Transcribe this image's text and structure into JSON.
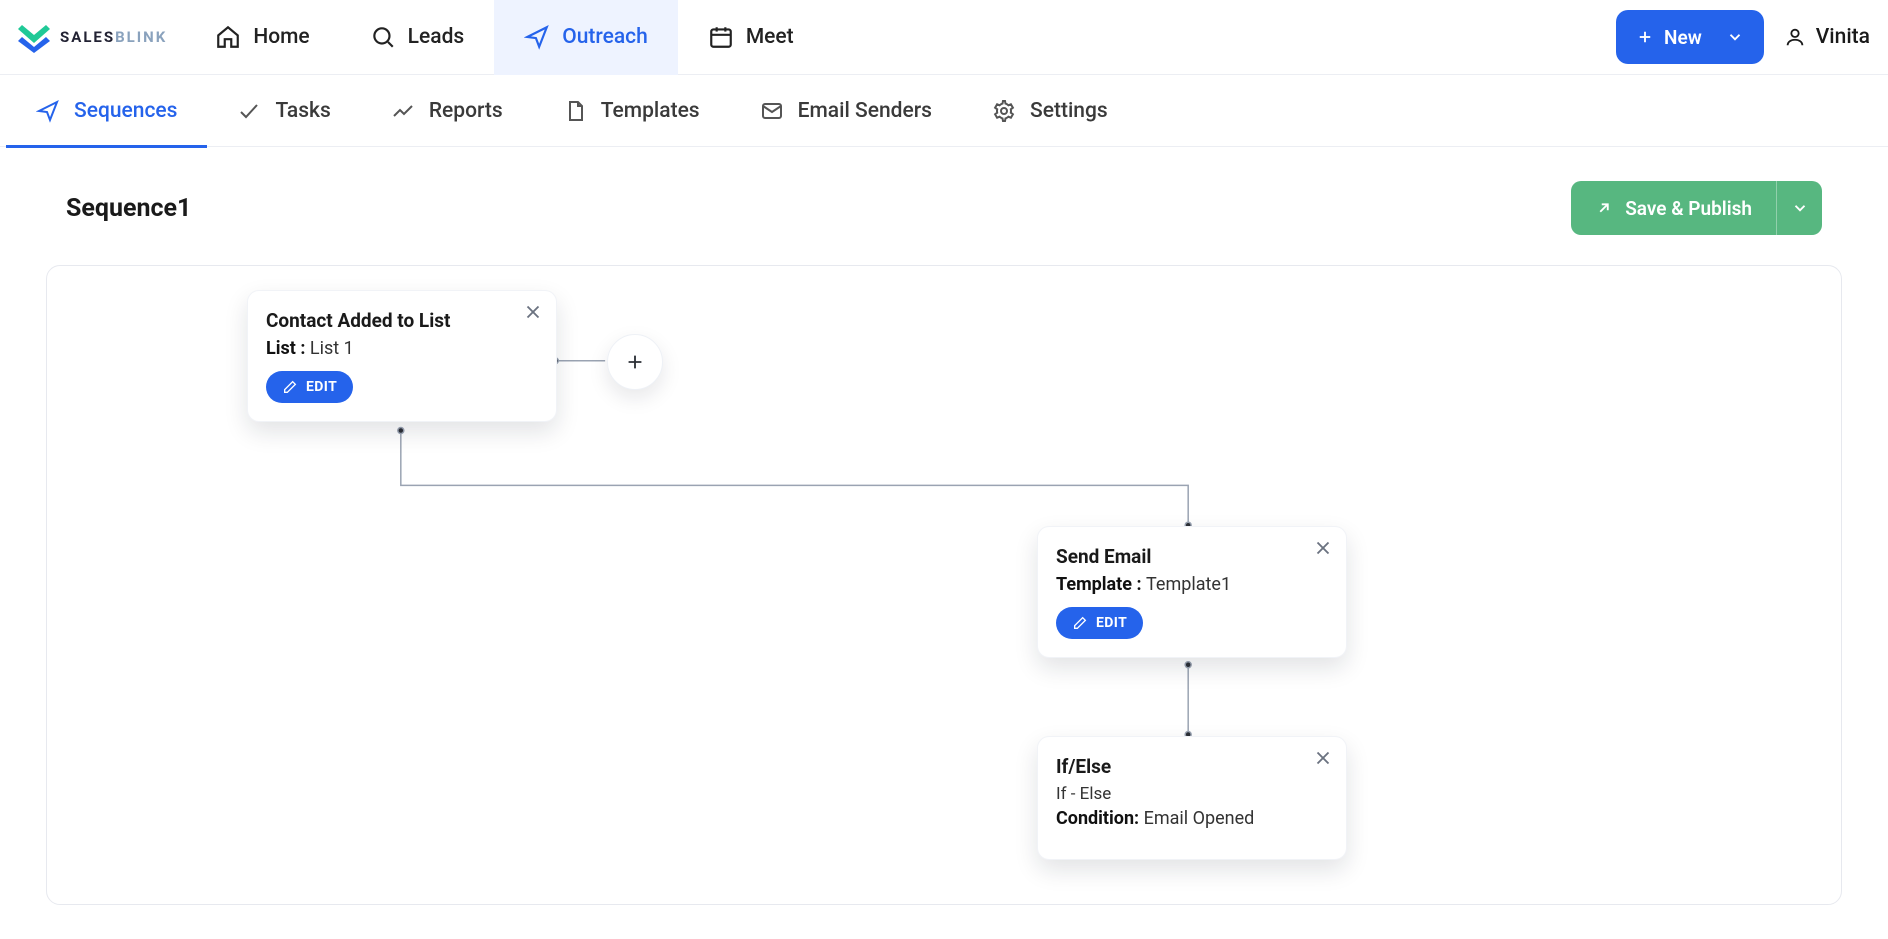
{
  "brand": {
    "name_primary": "SALES",
    "name_secondary": "BLINK"
  },
  "topnav": {
    "items": [
      {
        "label": "Home",
        "icon": "home-icon"
      },
      {
        "label": "Leads",
        "icon": "search-icon"
      },
      {
        "label": "Outreach",
        "icon": "send-icon"
      },
      {
        "label": "Meet",
        "icon": "calendar-icon"
      }
    ],
    "new_label": "New",
    "user_name": "Vinita"
  },
  "subnav": {
    "items": [
      {
        "label": "Sequences",
        "icon": "send-icon"
      },
      {
        "label": "Tasks",
        "icon": "check-icon"
      },
      {
        "label": "Reports",
        "icon": "chart-icon"
      },
      {
        "label": "Templates",
        "icon": "file-icon"
      },
      {
        "label": "Email Senders",
        "icon": "envelope-icon"
      },
      {
        "label": "Settings",
        "icon": "gear-icon"
      }
    ]
  },
  "page": {
    "title": "Sequence1",
    "publish_label": "Save & Publish"
  },
  "nodes": {
    "trigger": {
      "title": "Contact Added to List",
      "field_label": "List :",
      "field_value": "List 1",
      "edit_label": "EDIT"
    },
    "send": {
      "title": "Send Email",
      "field_label": "Template :",
      "field_value": "Template1",
      "edit_label": "EDIT"
    },
    "cond": {
      "title": "If/Else",
      "subtitle": "If - Else",
      "field_label": "Condition:",
      "field_value": "Email Opened"
    }
  },
  "colors": {
    "accent": "#2563eb",
    "success": "#57b780"
  }
}
